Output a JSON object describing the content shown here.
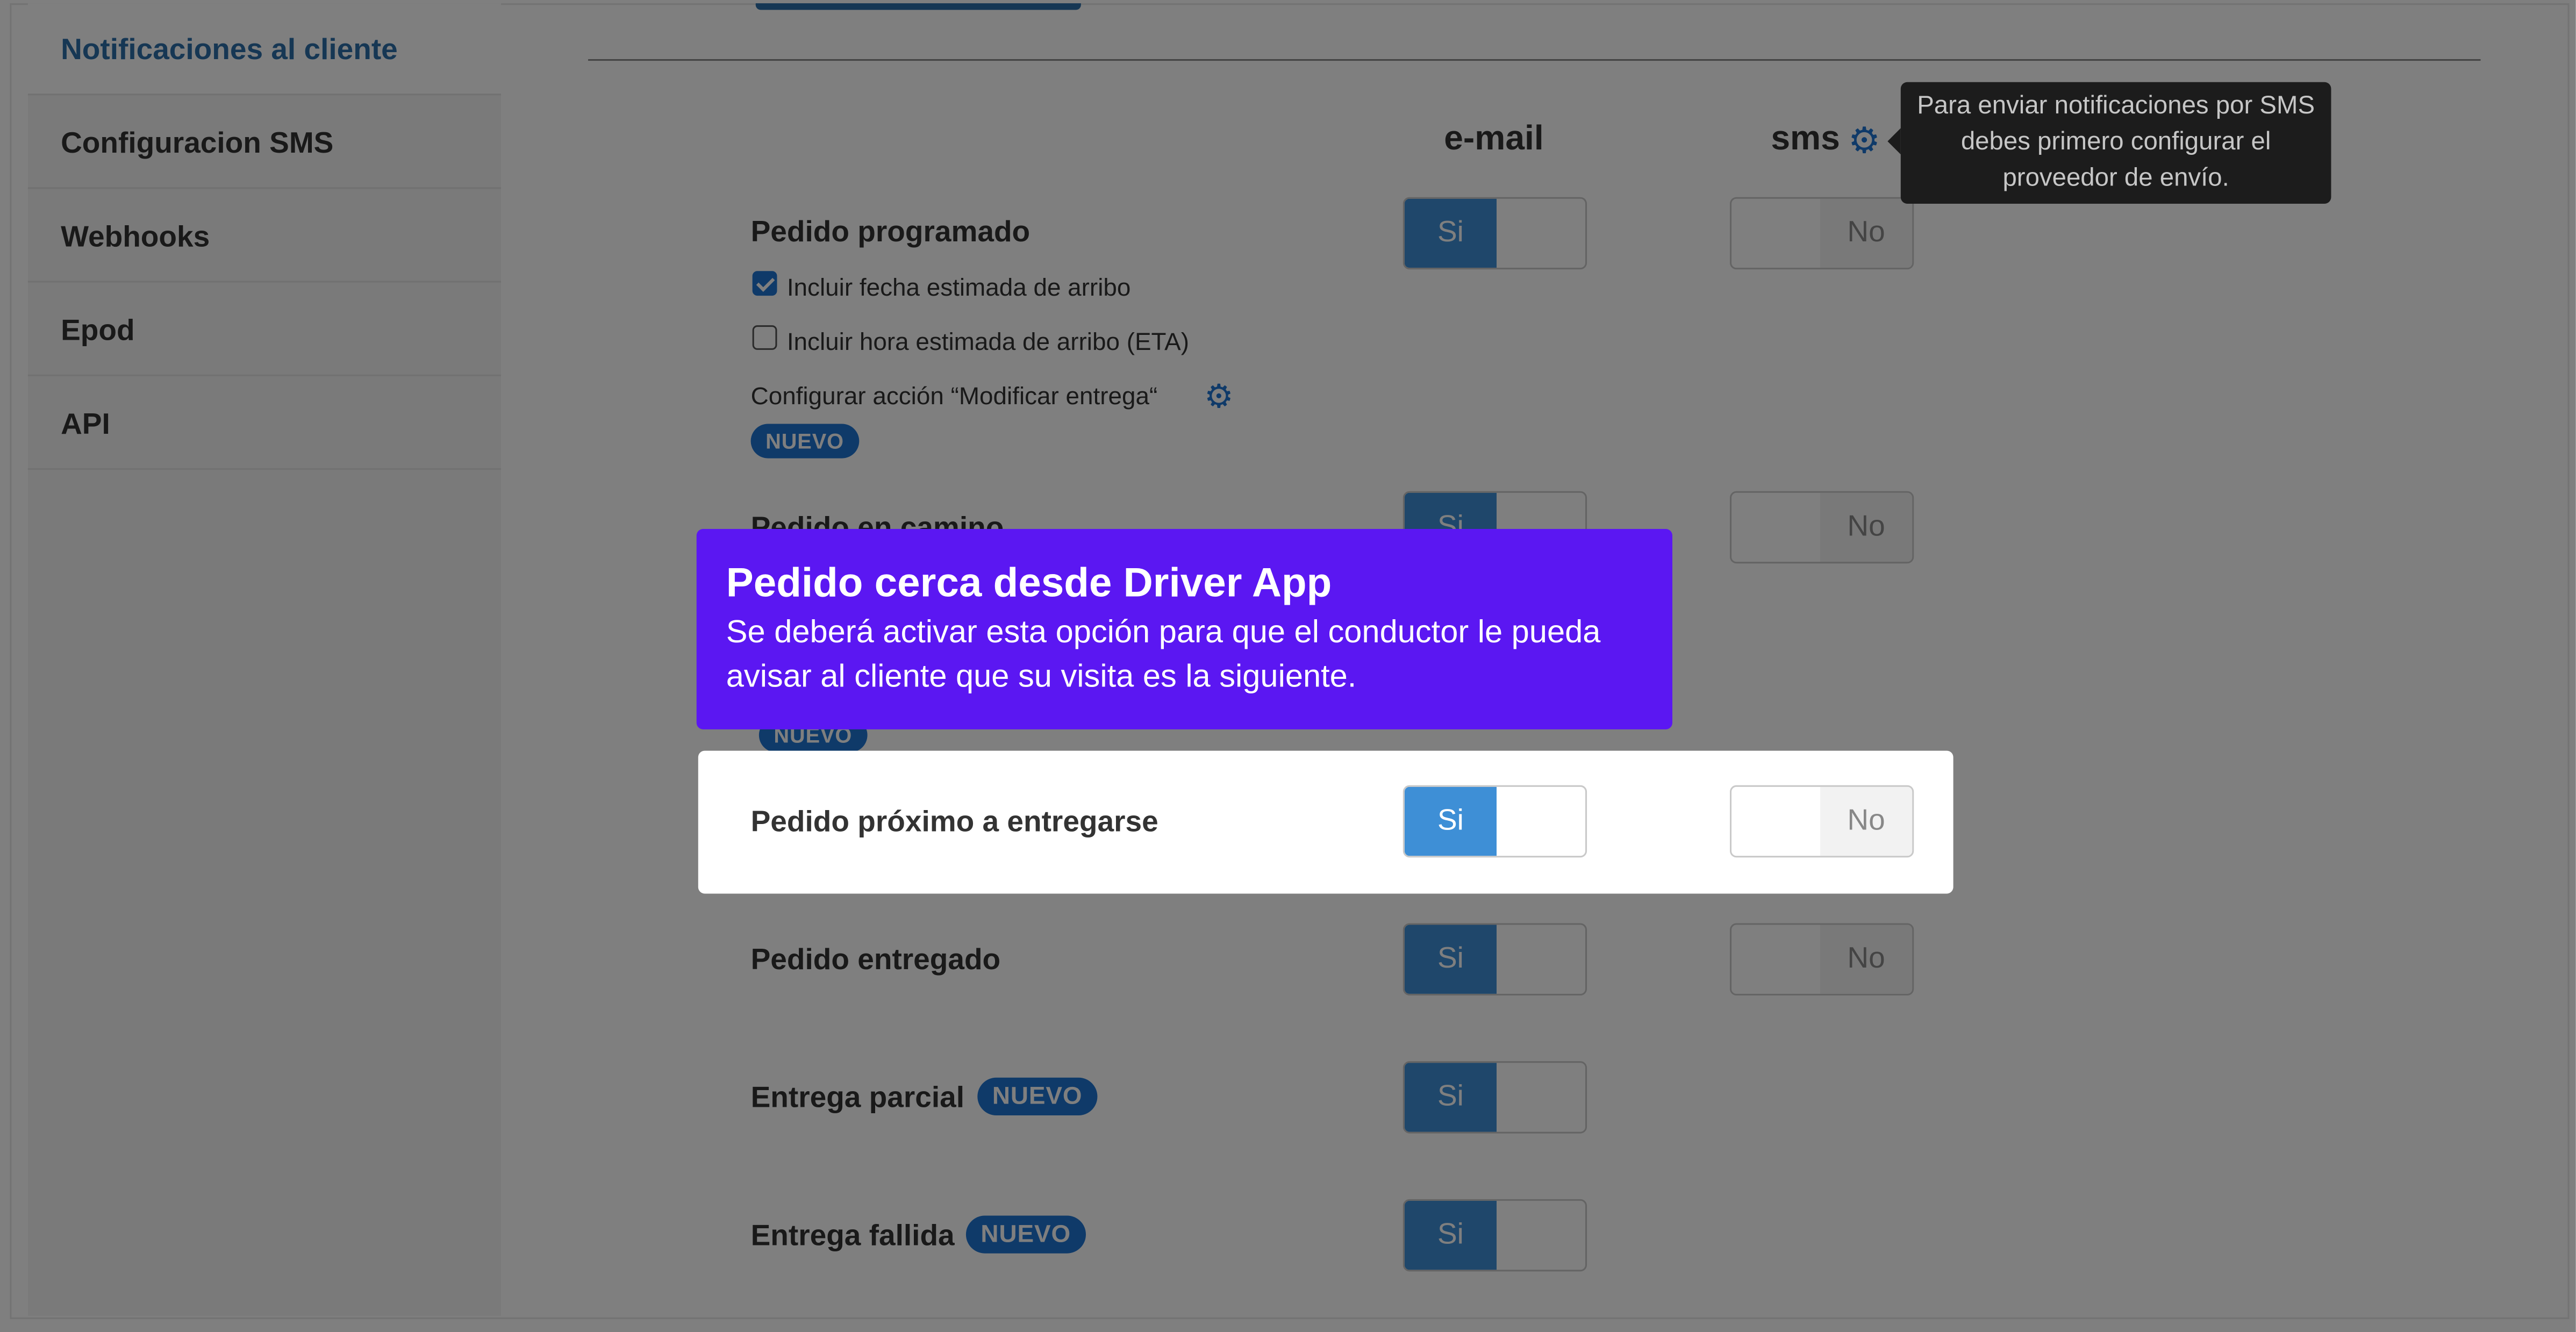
{
  "sidebar": {
    "items": [
      {
        "label": "Notificaciones al cliente",
        "active": true
      },
      {
        "label": "Configuracion SMS"
      },
      {
        "label": "Webhooks"
      },
      {
        "label": "Epod"
      },
      {
        "label": "API"
      }
    ]
  },
  "columns": {
    "email": "e-mail",
    "sms": "sms"
  },
  "tooltip": {
    "text": "Para enviar notificaciones por SMS debes primero configurar el proveedor de envío."
  },
  "toggle_labels": {
    "on": "Si",
    "off": "No"
  },
  "badge_label": "NUEVO",
  "rows": {
    "programado": {
      "label": "Pedido programado"
    },
    "eta_fecha": {
      "label": "Incluir fecha estimada de arribo",
      "checked": true
    },
    "eta_hora": {
      "label": "Incluir hora estimada de arribo (ETA)",
      "checked": false
    },
    "modificar": {
      "label": "Configurar acción “Modificar entrega“"
    },
    "en_camino": {
      "label": "Pedido en camino"
    },
    "proximo": {
      "label": "Pedido próximo a entregarse"
    },
    "entregado": {
      "label": "Pedido entregado"
    },
    "parcial": {
      "label": "Entrega parcial"
    },
    "fallida": {
      "label": "Entrega fallida"
    }
  },
  "popover": {
    "title": "Pedido cerca desde Driver App",
    "body": "Se deberá activar esta opción para que el conductor le pueda avisar al cliente que su visita es la siguiente."
  },
  "colors": {
    "accent": "#1f75d2",
    "toggle_on": "#3e8fd6",
    "popover_bg": "#5b17f2",
    "overlay": "rgba(0,0,0,0.5)"
  }
}
